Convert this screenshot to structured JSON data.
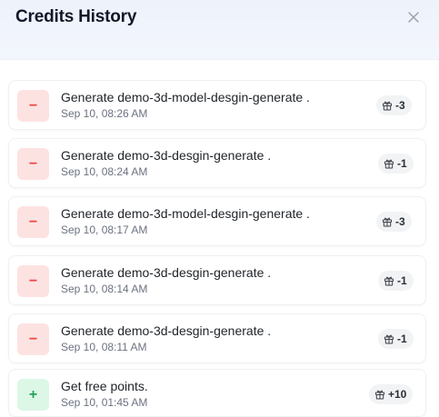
{
  "header": {
    "title": "Credits History"
  },
  "icons": {
    "close": "close-icon",
    "gift": "gift-icon"
  },
  "colors": {
    "debit_bg": "#fde2e2",
    "debit_fg": "#ef4444",
    "credit_bg": "#dcf7e6",
    "credit_fg": "#22a35a"
  },
  "items": [
    {
      "type": "debit",
      "sign": "−",
      "description": "Generate demo-3d-model-desgin-generate .",
      "time": "Sep 10, 08:26 AM",
      "amount": "-3"
    },
    {
      "type": "debit",
      "sign": "−",
      "description": "Generate demo-3d-desgin-generate .",
      "time": "Sep 10, 08:24 AM",
      "amount": "-1"
    },
    {
      "type": "debit",
      "sign": "−",
      "description": "Generate demo-3d-model-desgin-generate .",
      "time": "Sep 10, 08:17 AM",
      "amount": "-3"
    },
    {
      "type": "debit",
      "sign": "−",
      "description": "Generate demo-3d-desgin-generate .",
      "time": "Sep 10, 08:14 AM",
      "amount": "-1"
    },
    {
      "type": "debit",
      "sign": "−",
      "description": "Generate demo-3d-desgin-generate .",
      "time": "Sep 10, 08:11 AM",
      "amount": "-1"
    },
    {
      "type": "credit",
      "sign": "+",
      "description": "Get free points.",
      "time": "Sep 10, 01:45 AM",
      "amount": "+10"
    }
  ]
}
